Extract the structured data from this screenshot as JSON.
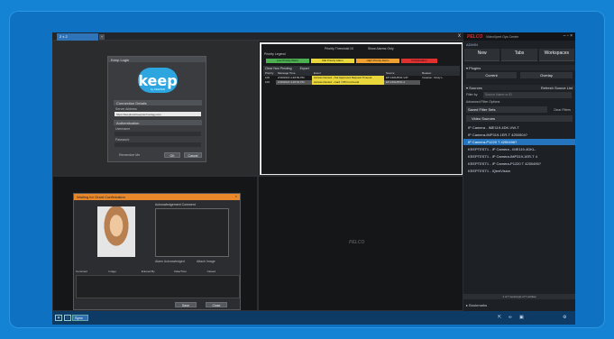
{
  "grid_tab": {
    "label": "2 x 2",
    "close": "x"
  },
  "login": {
    "title": "Keep Login",
    "logo": "keep",
    "logo_sub": "by KEEPER",
    "conn_section": "Connection Details",
    "server_label": "Server Address",
    "server_value": "https://keeplocal.keeptechnology.com",
    "auth_section": "Authentication",
    "username_label": "Username",
    "password_label": "Password",
    "remember": "Remember Me",
    "ok": "OK",
    "cancel": "Cancel"
  },
  "alarm": {
    "priority_threshold": "Priority Threshold",
    "threshold_value": "10",
    "show_alarms": "Show Alarms Only",
    "priority_legend": "Priority Legend",
    "legend": [
      "Low Priority Alarm",
      "Mid Priority Alarm",
      "High Priority Alarm",
      "Critical Alarm"
    ],
    "legend_colors": [
      "#4caf50",
      "#e8d63a",
      "#f0a030",
      "#e03030"
    ],
    "toolbar": [
      "Clear Non Pending",
      "Export"
    ],
    "columns": [
      "Priority",
      "Message Time",
      "Event",
      "Source",
      "Reason"
    ],
    "rows": [
      [
        "100",
        "2/18/2016 4:28:59 PM",
        "Access Denied - Not Approved Request Timeout",
        "EP-1601/8VD-V4T",
        "Invasion: Cindy L."
      ],
      [
        "100",
        "2/18/2016 4:28:54 PM",
        "Access Denied - Card / PIN not found",
        "EP-1601/8VD-4",
        ""
      ]
    ]
  },
  "waiting": {
    "title": "Waiting for Grant Confirmation",
    "ack_label": "Acknowledgement Comment",
    "alarm_ack": "Alarm Acknowledged",
    "attach": "Attach Image",
    "columns": [
      "Comment",
      "Image",
      "Entered By",
      "Date/Time",
      "Closed"
    ],
    "save": "Save",
    "close": "Close"
  },
  "viewer": {
    "watermark": "PELCO"
  },
  "right": {
    "brand": "PELCO",
    "app_title": "VideoXpert Ops Center",
    "admin": "ADMIN",
    "new": "New",
    "tabs": "Tabs",
    "workspaces": "Workspaces",
    "plugins": "Plugins",
    "current": "Current",
    "overlay": "Overlay",
    "sources": "Sources",
    "refresh": "Refresh Source List",
    "filter_by": "Filter by",
    "filter_placeholder": "Source Name or ID",
    "advanced": "Advanced Filter Options",
    "saved_sets": "Saved Filter Sets",
    "clear": "Clear Filters",
    "video_sources": "Video Sources",
    "list": [
      "IP Camera - IME119-4DK-VW-T",
      "IP Camera-IMP319-1ER-T 4250504?",
      "IP Camera-P1220 T 4250496?",
      "KEEPTEST1 - IP Camera - IME119-4DKL-",
      "KEEPTEST1 - IP Camera-IMP319-1ER-T 4",
      "KEEPTEST1 - IP Camera-P1220 T 4250495?",
      "KEEPTEST1 - IQeniVision"
    ],
    "footer": "1 of 7 source(s) of 7 entities",
    "bookmarks": "Bookmarks"
  },
  "bottombar": {
    "layout": "Sync"
  }
}
